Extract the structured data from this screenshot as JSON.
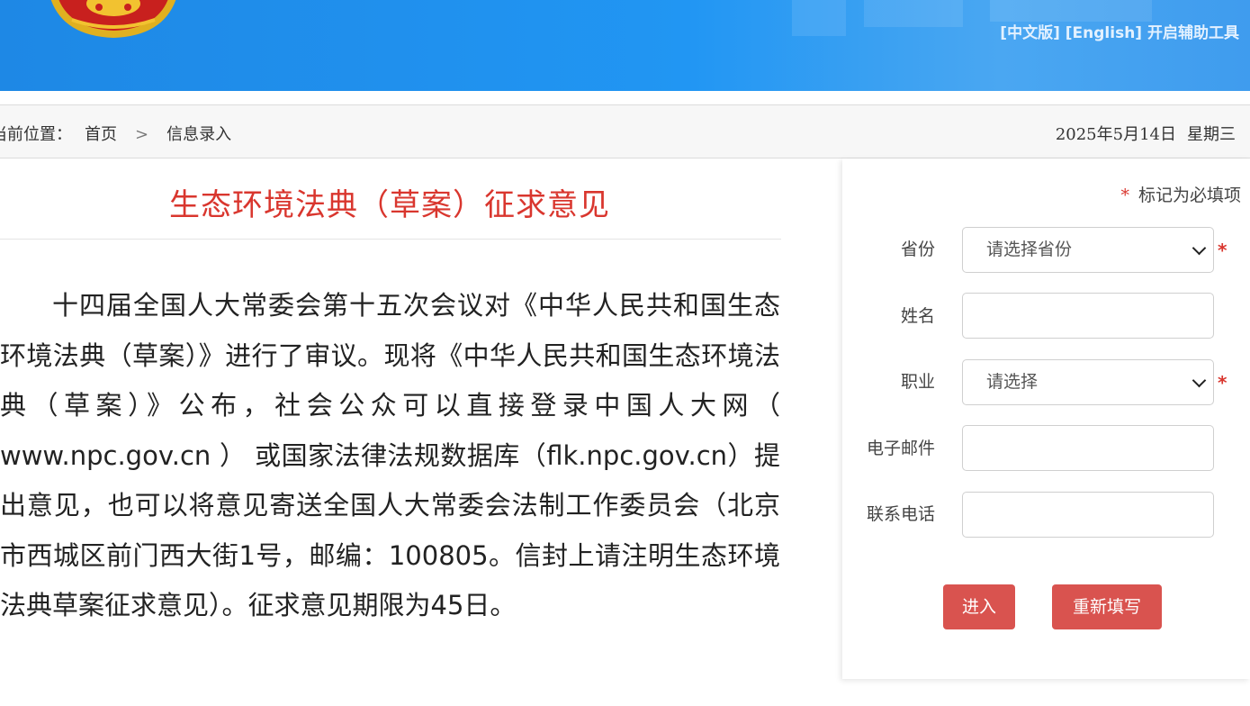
{
  "header": {
    "lang_zh": "[中文版]",
    "lang_en": "[English]",
    "accessibility": "开启辅助工具"
  },
  "breadcrumb": {
    "label": "当前位置：",
    "home": "首页",
    "separator": ">",
    "current": "信息录入"
  },
  "date": {
    "day": "2025年5月14日",
    "weekday": "星期三"
  },
  "article": {
    "title": "生态环境法典（草案）征求意见",
    "body": "十四届全国人大常委会第十五次会议对《中华人民共和国生态环境法典（草案）》进行了审议。现将《中华人民共和国生态环境法典（草案）》公布，社会公众可以直接登录中国人大网（ www.npc.gov.cn ） 或国家法律法规数据库（flk.npc.gov.cn）提出意见，也可以将意见寄送全国人大常委会法制工作委员会（北京市西城区前门西大街1号，邮编：100805。信封上请注明生态环境法典草案征求意见）。征求意见期限为45日。"
  },
  "form": {
    "required_star": "*",
    "required_note": "标记为必填项",
    "province_label": "省份",
    "province_value": "请选择省份",
    "name_label": "姓名",
    "name_value": "",
    "occupation_label": "职业",
    "occupation_value": "请选择",
    "email_label": "电子邮件",
    "email_value": "",
    "phone_label": "联系电话",
    "phone_value": "",
    "submit_label": "进入",
    "reset_label": "重新填写"
  },
  "colors": {
    "header_blue": "#2196f3",
    "title_red": "#d9362e",
    "button_red": "#d9534f"
  }
}
